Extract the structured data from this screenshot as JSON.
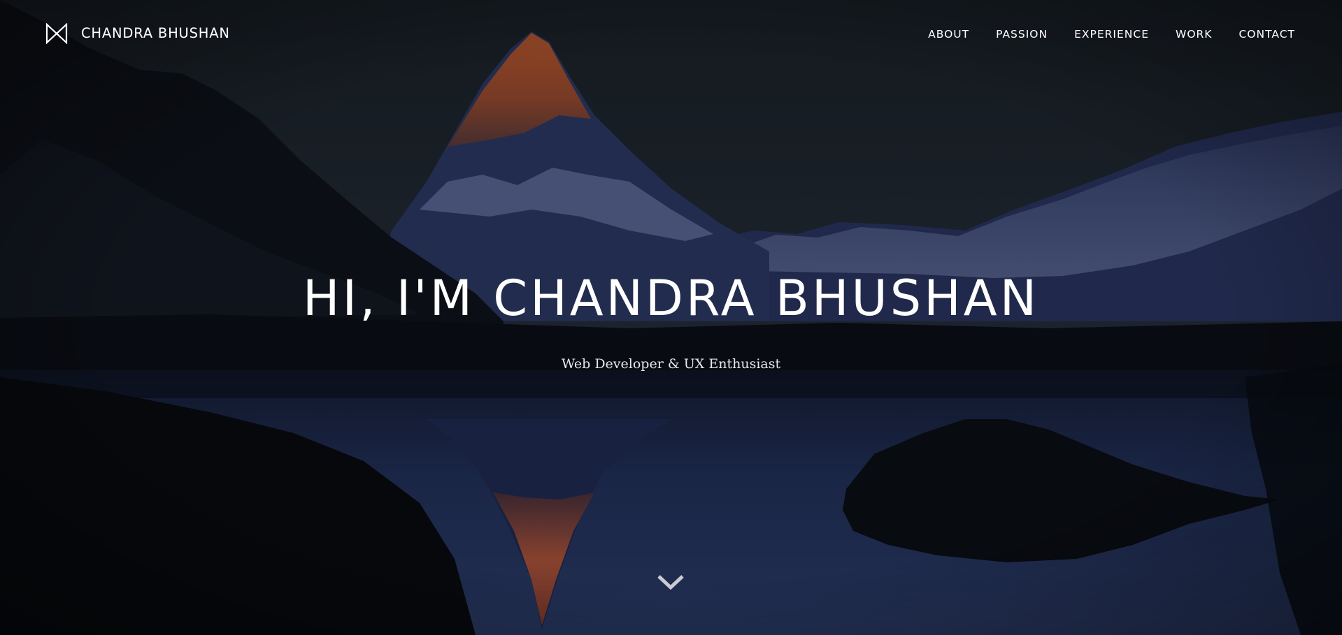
{
  "header": {
    "brand_name": "CHANDRA BHUSHAN",
    "logo_icon": "bowtie-logo-icon",
    "nav": [
      {
        "label": "ABOUT"
      },
      {
        "label": "PASSION"
      },
      {
        "label": "EXPERIENCE"
      },
      {
        "label": "WORK"
      },
      {
        "label": "CONTACT"
      }
    ]
  },
  "hero": {
    "headline": "HI, I'M CHANDRA BHUSHAN",
    "tagline": "Web Developer & UX Enthusiast",
    "background": "mountain-lake-reflection-image",
    "scroll_icon": "chevron-down-icon"
  },
  "colors": {
    "text": "#ffffff",
    "sky_dark": "#1b2128",
    "water_blue": "#2b3a6a",
    "peak_glow": "#c95a2e"
  }
}
